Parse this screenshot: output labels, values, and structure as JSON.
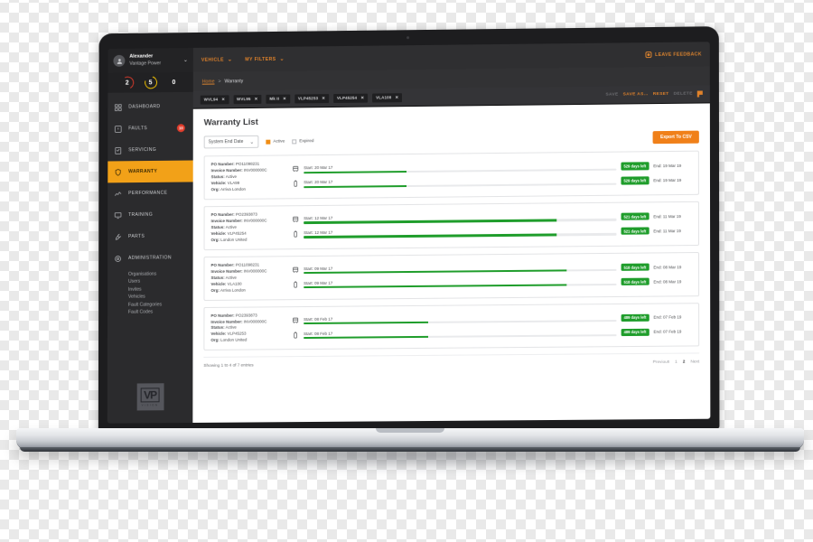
{
  "sidebar": {
    "user": {
      "name": "Alexander",
      "org": "Vantage Power",
      "avatar_icon": "user-avatar-icon",
      "caret_icon": "chevron-down-icon"
    },
    "kpis": [
      {
        "value": "2",
        "color": "#d93a2b"
      },
      {
        "value": "5",
        "color": "#f2c200"
      },
      {
        "value": "0",
        "color": "#ffffff"
      }
    ],
    "items": [
      {
        "label": "DASHBOARD",
        "icon": "dashboard-grid-icon",
        "active": false
      },
      {
        "label": "FAULTS",
        "icon": "alert-square-icon",
        "active": false,
        "badge": "10"
      },
      {
        "label": "SERVICING",
        "icon": "checklist-icon",
        "active": false
      },
      {
        "label": "WARRANTY",
        "icon": "shield-icon",
        "active": true
      },
      {
        "label": "PERFORMANCE",
        "icon": "chart-line-icon",
        "active": false
      },
      {
        "label": "TRAINING",
        "icon": "monitor-icon",
        "active": false
      },
      {
        "label": "PARTS",
        "icon": "wrench-icon",
        "active": false
      },
      {
        "label": "ADMINISTRATION",
        "icon": "gear-icon",
        "active": false
      }
    ],
    "sub_items": [
      "Organisations",
      "Users",
      "Invites",
      "Vehicles",
      "Fault Categories",
      "Fault Codes"
    ],
    "logo": {
      "mark": "VP",
      "word": "VISION"
    },
    "accent": "#f2a118"
  },
  "topbar": {
    "menus": [
      {
        "label": "VEHICLE",
        "caret_icon": "chevron-down-icon"
      },
      {
        "label": "MY FILTERS",
        "caret_icon": "chevron-down-icon"
      }
    ],
    "feedback_label": "LEAVE FEEDBACK",
    "feedback_icon": "feedback-bubble-icon",
    "ticket_icon": "ticket-card-icon",
    "accent": "#e0822a"
  },
  "breadcrumb": {
    "home": "Home",
    "separator": ">",
    "current": "Warranty"
  },
  "filterbar": {
    "chips": [
      {
        "label": "WVL94",
        "remove_icon": "close-icon"
      },
      {
        "label": "WVL95",
        "remove_icon": "close-icon"
      },
      {
        "label": "Mk II",
        "remove_icon": "close-icon"
      },
      {
        "label": "VLP45253",
        "remove_icon": "close-icon"
      },
      {
        "label": "VLP45254",
        "remove_icon": "close-icon"
      },
      {
        "label": "VLA100",
        "remove_icon": "close-icon"
      }
    ],
    "actions": [
      {
        "label": "SAVE",
        "state": "dim"
      },
      {
        "label": "SAVE AS...",
        "state": "on"
      },
      {
        "label": "RESET",
        "state": "on"
      },
      {
        "label": "DELETE",
        "state": "dim"
      }
    ],
    "flag_icon": "flag-icon"
  },
  "main": {
    "title": "Warranty List",
    "sort_select": {
      "value": "System End Date",
      "caret_icon": "chevron-down-icon"
    },
    "checkboxes": [
      {
        "label": "Active",
        "checked": true
      },
      {
        "label": "Expired",
        "checked": false
      }
    ],
    "export_label": "Export To CSV",
    "labels": {
      "po": "PO Number:",
      "invoice": "Invoice Number:",
      "status": "Status:",
      "vehicle": "Vehicle:",
      "org": "Org:",
      "start": "Start:",
      "end": "End:"
    },
    "rows": [
      {
        "po": "PO11098231",
        "invoice": "INV000000C",
        "status": "Active",
        "vehicle": "VLA99",
        "org": "Arriva London",
        "bars": [
          {
            "icon": "bus-icon",
            "start": "20 Mar 17",
            "fill_pct": 33,
            "days_left": "529 days left",
            "end": "19 Mar 19"
          },
          {
            "icon": "battery-icon",
            "start": "20 Mar 17",
            "fill_pct": 33,
            "days_left": "529 days left",
            "end": "19 Mar 19"
          }
        ]
      },
      {
        "po": "PO2393873",
        "invoice": "INV000000C",
        "status": "Active",
        "vehicle": "VLP45254",
        "org": "London United",
        "bars": [
          {
            "icon": "bus-icon",
            "start": "12 Mar 17",
            "fill_pct": 81,
            "days_left": "521 days left",
            "end": "11 Mar 19"
          },
          {
            "icon": "battery-icon",
            "start": "12 Mar 17",
            "fill_pct": 81,
            "days_left": "521 days left",
            "end": "11 Mar 19"
          }
        ]
      },
      {
        "po": "PO11098231",
        "invoice": "INV000000C",
        "status": "Active",
        "vehicle": "VLA100",
        "org": "Arriva London",
        "bars": [
          {
            "icon": "bus-icon",
            "start": "09 Mar 17",
            "fill_pct": 84,
            "days_left": "518 days left",
            "end": "08 Mar 19"
          },
          {
            "icon": "battery-icon",
            "start": "09 Mar 17",
            "fill_pct": 84,
            "days_left": "518 days left",
            "end": "08 Mar 19"
          }
        ]
      },
      {
        "po": "PO2393873",
        "invoice": "INV000000C",
        "status": "Active",
        "vehicle": "VLP45253",
        "org": "London United",
        "bars": [
          {
            "icon": "bus-icon",
            "start": "08 Feb 17",
            "fill_pct": 40,
            "days_left": "489 days left",
            "end": "07 Feb 19"
          },
          {
            "icon": "battery-icon",
            "start": "08 Feb 17",
            "fill_pct": 40,
            "days_left": "489 days left",
            "end": "07 Feb 19"
          }
        ]
      }
    ],
    "footer": {
      "showing": "Showing 1 to 4 of 7 entries",
      "pager": [
        {
          "label": "Previous",
          "current": false
        },
        {
          "label": "1",
          "current": false
        },
        {
          "label": "2",
          "current": true
        },
        {
          "label": "Next",
          "current": false
        }
      ]
    }
  }
}
